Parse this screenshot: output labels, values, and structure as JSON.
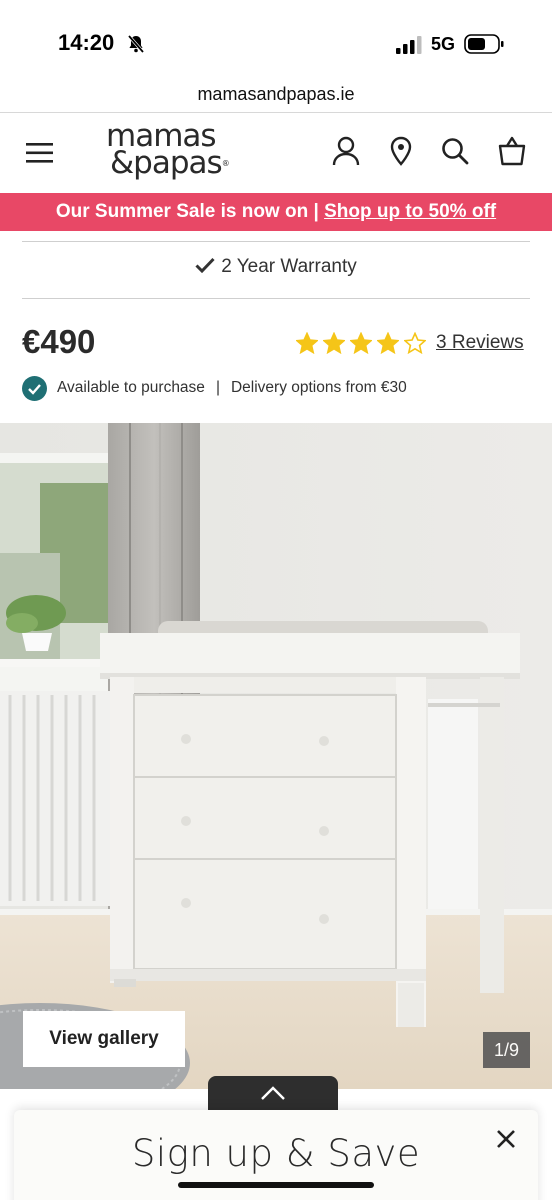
{
  "status_bar": {
    "time": "14:20",
    "network": "5G"
  },
  "browser": {
    "url": "mamasandpapas.ie"
  },
  "header": {
    "logo_line1": "mamas",
    "logo_line2": "&papas",
    "logo_reg": "®"
  },
  "promo": {
    "text": "Our Summer Sale is now on | ",
    "link": "Shop up to 50% off",
    "color": "#e84866"
  },
  "warranty": {
    "text": "2 Year Warranty"
  },
  "product": {
    "price": "€490",
    "rating": 4,
    "rating_max": 5,
    "reviews_label": "3 Reviews",
    "availability": "Available to purchase",
    "separator": "|",
    "delivery": "Delivery options from €30",
    "accent_color": "#1f6f74",
    "star_color": "#f5c518"
  },
  "gallery": {
    "button_label": "View gallery",
    "counter": "1/9"
  },
  "signup": {
    "title": "Sign up & Save"
  }
}
